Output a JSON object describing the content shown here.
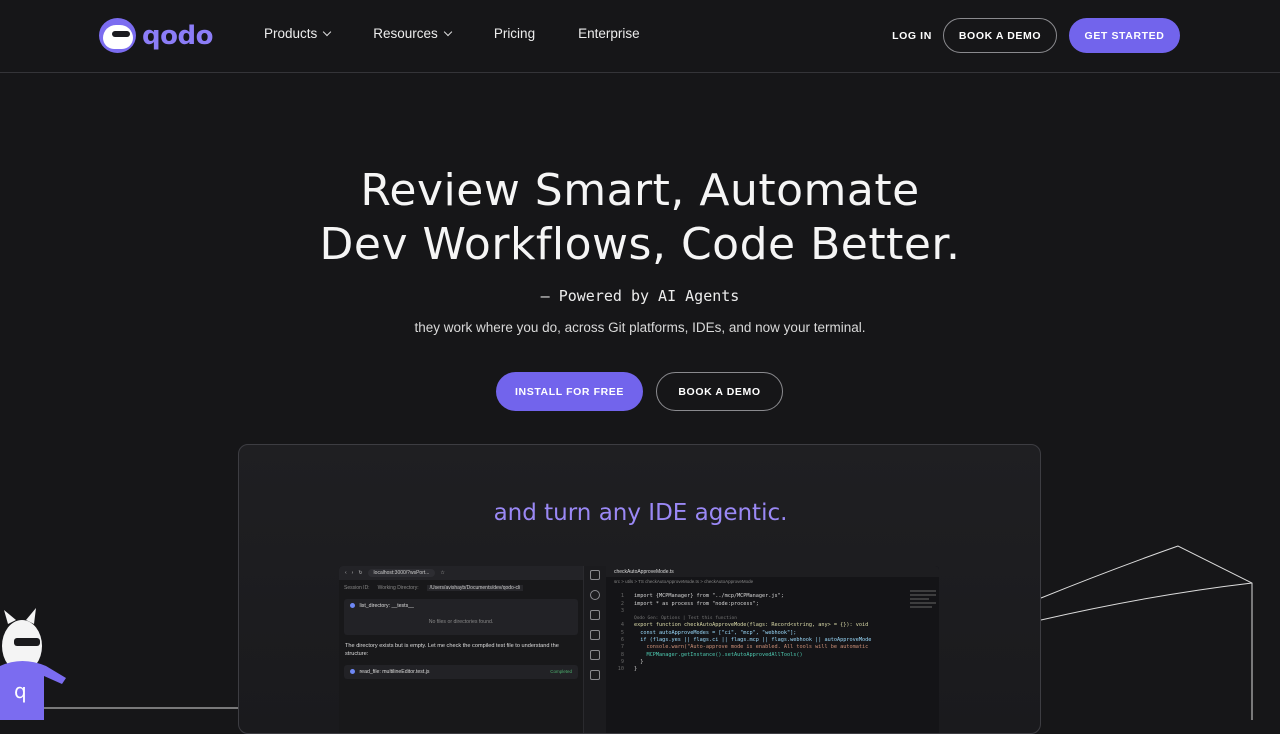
{
  "brand": {
    "name": "qodo",
    "accent": "#7264ec"
  },
  "nav": {
    "items": [
      {
        "label": "Products",
        "has_dropdown": true
      },
      {
        "label": "Resources",
        "has_dropdown": true
      },
      {
        "label": "Pricing",
        "has_dropdown": false
      },
      {
        "label": "Enterprise",
        "has_dropdown": false
      }
    ],
    "login_label": "LOG IN",
    "demo_label": "BOOK A DEMO",
    "start_label": "GET STARTED"
  },
  "hero": {
    "title_line1": "Review Smart, Automate",
    "title_line2": "Dev Workflows, Code Better.",
    "subtitle": "— Powered by AI Agents",
    "description": "they work where you do, across Git platforms, IDEs, and now your terminal.",
    "install_label": "INSTALL FOR FREE",
    "demo_label": "BOOK A DEMO"
  },
  "showcase": {
    "title": "and turn any IDE agentic.",
    "browser": {
      "url": "localhost:3000/?wsPort...",
      "session_label": "Session ID:",
      "workdir_label": "Working Directory:",
      "workdir_value": "/Users/avishayb/Documents/dev/qodo-cli",
      "tool1": "list_directory: __tests__",
      "empty_msg": "No files or directories found.",
      "message": "The directory exists but is empty. Let me check the compiled test file to understand the structure:",
      "tool2": "read_file: multilineEditor.test.js",
      "status": "Completed"
    },
    "editor": {
      "tab": "checkAutoApproveMode.ts",
      "breadcrumb": "src > utils > TS checkAutoApproveMode.ts > checkAutoApproveMode",
      "codelens": "Qodo Gen: Options | Test this function",
      "lines": [
        {
          "n": "1",
          "code": "import {MCPManager} from \"../mcp/MCPManager.js\";"
        },
        {
          "n": "2",
          "code": "import * as process from \"node:process\";"
        },
        {
          "n": "3",
          "code": ""
        },
        {
          "n": "4",
          "code": "export function checkAutoApproveMode(flags: Record<string, any> = {}): void"
        },
        {
          "n": "5",
          "code": "  const autoApproveModes = [\"ci\", \"mcp\", \"webhook\"];"
        },
        {
          "n": "6",
          "code": "  if (flags.yes || flags.ci || flags.mcp || flags.webhook || autoApproveMode"
        },
        {
          "n": "7",
          "code": "    console.warn(\"Auto-approve mode is enabled. All tools will be automatic"
        },
        {
          "n": "8",
          "code": "    MCPManager.getInstance().setAutoApprovedAllTools()"
        },
        {
          "n": "9",
          "code": "  }"
        },
        {
          "n": "10",
          "code": "}"
        }
      ]
    }
  }
}
